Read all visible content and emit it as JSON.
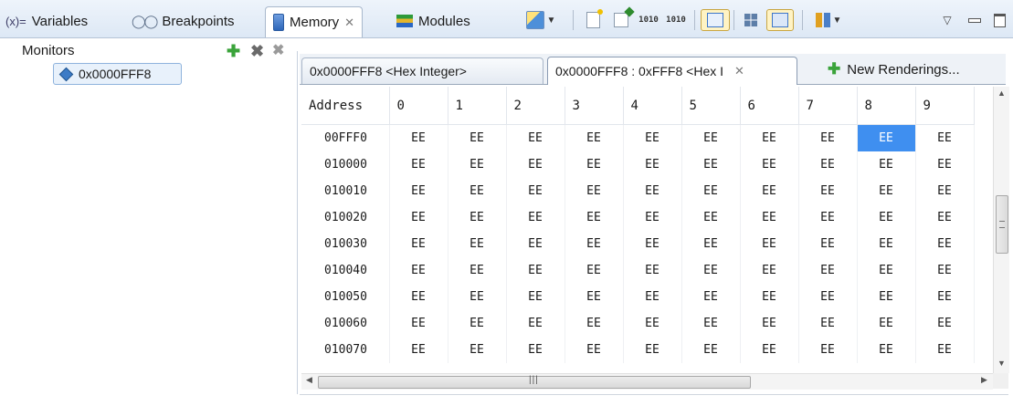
{
  "view_tabs": [
    {
      "label": "Variables",
      "icon": "variables-icon",
      "prefix": "(x)="
    },
    {
      "label": "Breakpoints",
      "icon": "breakpoints-icon"
    },
    {
      "label": "Memory",
      "icon": "memory-icon",
      "active": true
    },
    {
      "label": "Modules",
      "icon": "modules-icon"
    }
  ],
  "toolbar": {
    "bits_up": "1010",
    "bits_down": "1010"
  },
  "monitors": {
    "title": "Monitors",
    "items": [
      "0x0000FFF8"
    ]
  },
  "renderings": {
    "tabs": [
      {
        "label": "0x0000FFF8 <Hex Integer>"
      },
      {
        "label": "0x0000FFF8 : 0xFFF8 <Hex I",
        "active": true
      }
    ],
    "new_label": "New Renderings..."
  },
  "memory_table": {
    "address_header": "Address",
    "columns": [
      "0",
      "1",
      "2",
      "3",
      "4",
      "5",
      "6",
      "7",
      "8",
      "9"
    ],
    "rows": [
      {
        "address": "00FFF0",
        "bytes": [
          "EE",
          "EE",
          "EE",
          "EE",
          "EE",
          "EE",
          "EE",
          "EE",
          "EE",
          "EE"
        ]
      },
      {
        "address": "010000",
        "bytes": [
          "EE",
          "EE",
          "EE",
          "EE",
          "EE",
          "EE",
          "EE",
          "EE",
          "EE",
          "EE"
        ]
      },
      {
        "address": "010010",
        "bytes": [
          "EE",
          "EE",
          "EE",
          "EE",
          "EE",
          "EE",
          "EE",
          "EE",
          "EE",
          "EE"
        ]
      },
      {
        "address": "010020",
        "bytes": [
          "EE",
          "EE",
          "EE",
          "EE",
          "EE",
          "EE",
          "EE",
          "EE",
          "EE",
          "EE"
        ]
      },
      {
        "address": "010030",
        "bytes": [
          "EE",
          "EE",
          "EE",
          "EE",
          "EE",
          "EE",
          "EE",
          "EE",
          "EE",
          "EE"
        ]
      },
      {
        "address": "010040",
        "bytes": [
          "EE",
          "EE",
          "EE",
          "EE",
          "EE",
          "EE",
          "EE",
          "EE",
          "EE",
          "EE"
        ]
      },
      {
        "address": "010050",
        "bytes": [
          "EE",
          "EE",
          "EE",
          "EE",
          "EE",
          "EE",
          "EE",
          "EE",
          "EE",
          "EE"
        ]
      },
      {
        "address": "010060",
        "bytes": [
          "EE",
          "EE",
          "EE",
          "EE",
          "EE",
          "EE",
          "EE",
          "EE",
          "EE",
          "EE"
        ]
      },
      {
        "address": "010070",
        "bytes": [
          "EE",
          "EE",
          "EE",
          "EE",
          "EE",
          "EE",
          "EE",
          "EE",
          "EE",
          "EE"
        ]
      }
    ],
    "selected": {
      "row": 0,
      "col": 8
    }
  },
  "colors": {
    "selection": "#3f8ff0",
    "add_green": "#3aa33a",
    "tab_border": "#a9b6c8"
  }
}
